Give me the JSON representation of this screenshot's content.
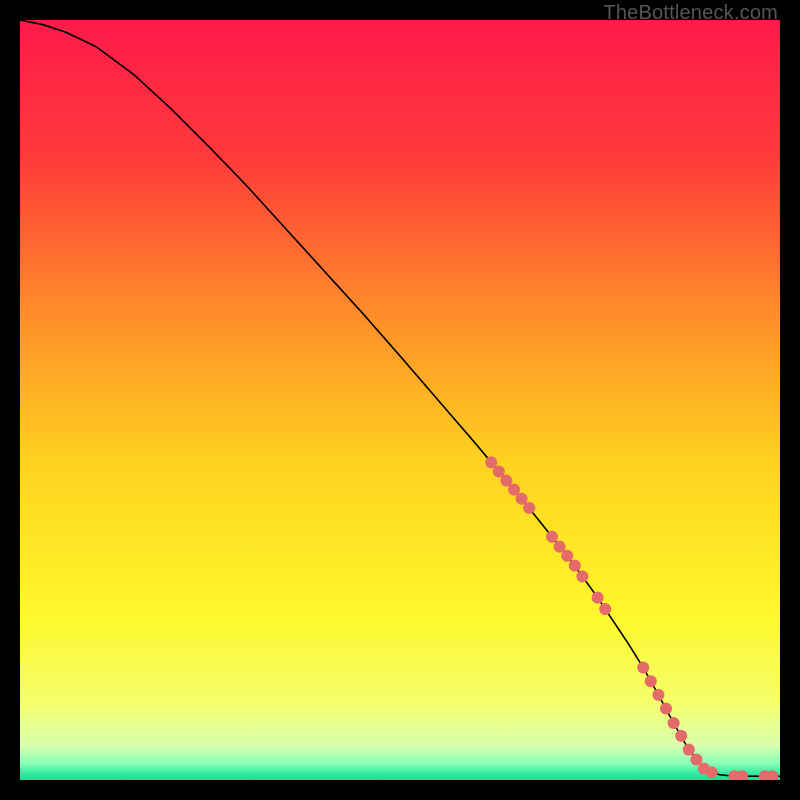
{
  "watermark": "TheBottleneck.com",
  "chart_data": {
    "type": "line",
    "title": "",
    "xlabel": "",
    "ylabel": "",
    "xlim": [
      0,
      100
    ],
    "ylim": [
      0,
      100
    ],
    "grid": false,
    "series": [
      {
        "name": "curve",
        "color": "#000000",
        "x": [
          0,
          3,
          6,
          10,
          15,
          20,
          25,
          30,
          35,
          40,
          45,
          50,
          55,
          60,
          62,
          64,
          66,
          68,
          70,
          72,
          74,
          76,
          78,
          80,
          82,
          84,
          86,
          88,
          90,
          92,
          94,
          96,
          98,
          100
        ],
        "y": [
          100,
          99.4,
          98.4,
          96.5,
          92.8,
          88.2,
          83.2,
          78.0,
          72.5,
          67.0,
          61.5,
          55.8,
          50.0,
          44.2,
          41.8,
          39.4,
          37.0,
          34.5,
          32.0,
          29.5,
          26.8,
          24.0,
          21.0,
          18.0,
          14.8,
          11.2,
          7.5,
          4.0,
          1.5,
          0.7,
          0.5,
          0.5,
          0.5,
          0.5
        ]
      }
    ],
    "points": {
      "name": "markers",
      "color": "#e56a6a",
      "radius_px": 6,
      "x": [
        62,
        63,
        64,
        65,
        66,
        67,
        70,
        71,
        72,
        73,
        74,
        76,
        77,
        82,
        83,
        84,
        85,
        86,
        87,
        88,
        89,
        90,
        91,
        94,
        95,
        98,
        99
      ],
      "y": [
        41.8,
        40.6,
        39.4,
        38.2,
        37.0,
        35.8,
        32.0,
        30.7,
        29.5,
        28.2,
        26.8,
        24.0,
        22.5,
        14.8,
        13.0,
        11.2,
        9.4,
        7.5,
        5.8,
        4.0,
        2.7,
        1.5,
        1.0,
        0.5,
        0.5,
        0.5,
        0.5
      ]
    },
    "background_gradient": {
      "stops": [
        {
          "offset": 0.0,
          "color": "#ff1a4b"
        },
        {
          "offset": 0.18,
          "color": "#ff3a3a"
        },
        {
          "offset": 0.38,
          "color": "#ff8a2a"
        },
        {
          "offset": 0.58,
          "color": "#ffd21f"
        },
        {
          "offset": 0.78,
          "color": "#fff72a"
        },
        {
          "offset": 0.9,
          "color": "#f4ff6a"
        },
        {
          "offset": 0.955,
          "color": "#d8ffb0"
        },
        {
          "offset": 0.978,
          "color": "#8affb8"
        },
        {
          "offset": 0.992,
          "color": "#2fe8a0"
        },
        {
          "offset": 1.0,
          "color": "#1adf93"
        }
      ]
    }
  }
}
